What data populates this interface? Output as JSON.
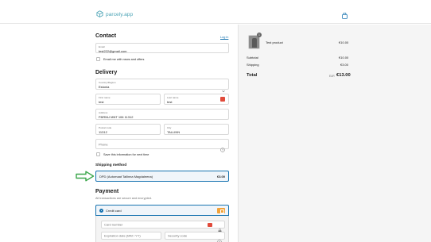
{
  "header": {
    "logo_text": "parcely.app"
  },
  "contact": {
    "heading": "Contact",
    "login_link": "Log in",
    "email_label": "Email",
    "email_value": "test222@gmail.com",
    "newsletter_label": "Email me with news and offers"
  },
  "delivery": {
    "heading": "Delivery",
    "country_label": "Country/Region",
    "country_value": "Estonia",
    "first_name_label": "First name",
    "first_name_value": "test",
    "last_name_label": "Last name",
    "last_name_value": "test",
    "address_label": "Address",
    "address_value": "PÄRNU MNT 106 11312",
    "postal_label": "Postal code",
    "postal_value": "11312",
    "city_label": "City",
    "city_value": "TALLINN",
    "phone_placeholder": "Phone",
    "save_info_label": "Save this information for next time"
  },
  "shipping": {
    "heading": "Shipping method",
    "option_name": "DPD (Automaat Tallinna Magdaleena)",
    "option_price": "€3.00"
  },
  "payment": {
    "heading": "Payment",
    "subtext": "All transactions are secure and encrypted.",
    "method_label": "Credit card",
    "card_number_placeholder": "Card number",
    "expiration_placeholder": "Expiration date (MM / YY)",
    "security_placeholder": "Security code"
  },
  "summary": {
    "product_name": "Test product",
    "product_price": "€10.00",
    "quantity": "1",
    "subtotal_label": "Subtotal",
    "subtotal_value": "€10.00",
    "shipping_label": "Shipping",
    "shipping_value": "€3.00",
    "total_label": "Total",
    "currency": "EUR",
    "total_value": "€13.00"
  },
  "colors": {
    "accent": "#1773b0",
    "logo": "#4aa3b5",
    "arrow": "#3aa64a",
    "card_badge": "#f2a33a"
  }
}
